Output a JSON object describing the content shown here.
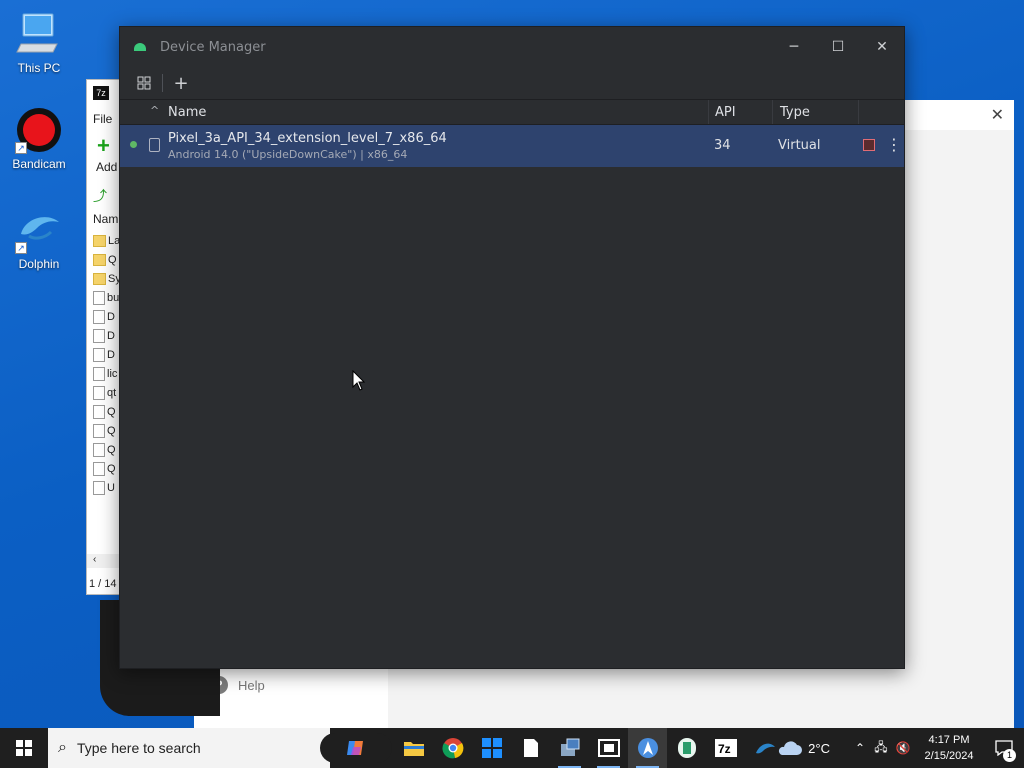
{
  "desktop": {
    "icons": [
      {
        "label": "This PC",
        "icon": "computer-icon"
      },
      {
        "label": "Bandicam",
        "icon": "bandicam-icon"
      },
      {
        "label": "Dolphin",
        "icon": "dolphin-icon"
      }
    ]
  },
  "bg_7zip": {
    "menu_file": "File",
    "toolbar_add": "Add",
    "column_name": "Nam",
    "rows": [
      "La",
      "Q",
      "Sy",
      "bu",
      "D",
      "D",
      "D",
      "lic",
      "qt",
      "Q",
      "Q",
      "Q",
      "Q",
      "U"
    ],
    "status": "1 / 14"
  },
  "bg_dialog": {
    "help_label": "Help"
  },
  "device_manager": {
    "title": "Device Manager",
    "columns": {
      "name": "Name",
      "api": "API",
      "type": "Type"
    },
    "devices": [
      {
        "name": "Pixel_3a_API_34_extension_level_7_x86_64",
        "subtitle": "Android 14.0 (\"UpsideDownCake\") | x86_64",
        "api": "34",
        "type": "Virtual",
        "status": "running"
      }
    ]
  },
  "taskbar": {
    "search_placeholder": "Type here to search",
    "weather": "2°C",
    "time": "4:17 PM",
    "date": "2/15/2024",
    "notification_count": "1",
    "apps": [
      "file-explorer-icon",
      "chrome-icon",
      "windows-store-icon",
      "notepad-icon",
      "control-panel-icon",
      "film-icon",
      "android-studio-icon",
      "app-icon",
      "7zip-icon",
      "dolphin-icon"
    ]
  }
}
